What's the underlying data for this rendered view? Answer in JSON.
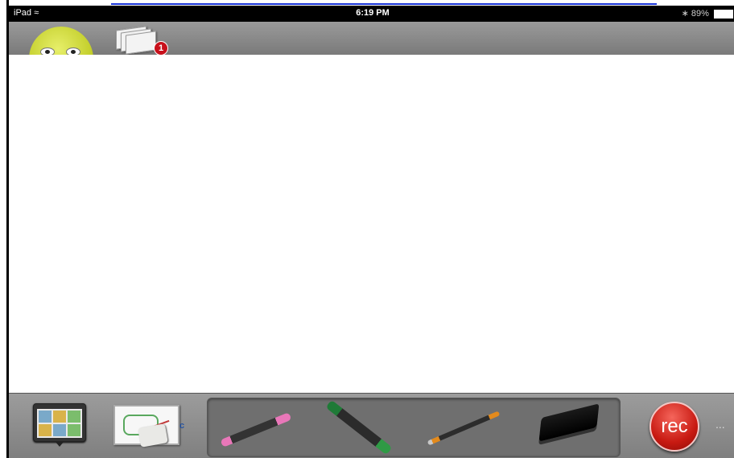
{
  "status_bar": {
    "device": "iPad",
    "wifi_icon": "wifi-icon",
    "time": "6:19 PM",
    "bluetooth_icon": "bluetooth-icon",
    "battery": "89%"
  },
  "toolbar": {
    "avatar_icon": "character-avatar-icon",
    "pages_icon": "pages-stack-icon",
    "pages_badge": "1"
  },
  "bottom_toolbar": {
    "gallery_icon": "image-gallery-icon",
    "whiteboard_icon": "whiteboard-clear-icon",
    "whiteboard_letter": "c",
    "tools": [
      "pink-marker-icon",
      "green-marker-icon",
      "pencil-icon",
      "eraser-icon"
    ],
    "record_label": "rec",
    "more_label": "..."
  },
  "colors": {
    "record": "#c81a12",
    "badge": "#c8101b",
    "toolbar": "#8a8a8a",
    "link_underline": "#1a35d8"
  }
}
